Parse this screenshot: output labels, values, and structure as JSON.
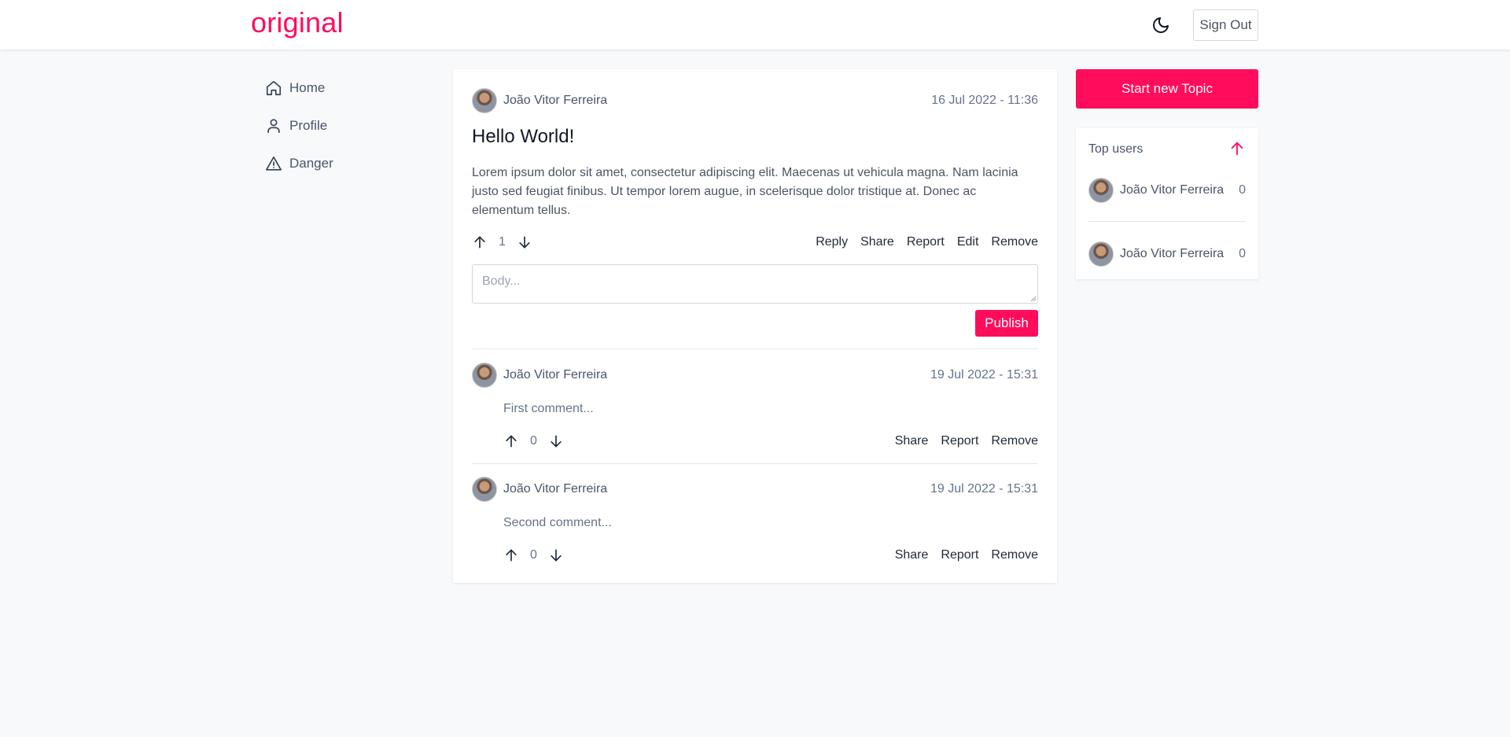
{
  "header": {
    "logo": "original",
    "sign_out_label": "Sign Out"
  },
  "sidebar": {
    "items": [
      {
        "label": "Home",
        "icon": "home-icon"
      },
      {
        "label": "Profile",
        "icon": "user-icon"
      },
      {
        "label": "Danger",
        "icon": "warning-icon"
      }
    ]
  },
  "post": {
    "author": "João Vitor Ferreira",
    "date": "16 Jul 2022 - 11:36",
    "title": "Hello World!",
    "body": "Lorem ipsum dolor sit amet, consectetur adipiscing elit. Maecenas ut vehicula magna. Nam lacinia justo sed feugiat finibus. Ut tempor lorem augue, in scelerisque dolor tristique at. Donec ac elementum tellus.",
    "votes": "1",
    "actions": {
      "reply": "Reply",
      "share": "Share",
      "report": "Report",
      "edit": "Edit",
      "remove": "Remove"
    }
  },
  "reply_form": {
    "placeholder": "Body...",
    "publish_label": "Publish"
  },
  "comments": [
    {
      "author": "João Vitor Ferreira",
      "date": "19 Jul 2022 - 15:31",
      "text": "First comment...",
      "votes": "0",
      "actions": {
        "share": "Share",
        "report": "Report",
        "remove": "Remove"
      }
    },
    {
      "author": "João Vitor Ferreira",
      "date": "19 Jul 2022 - 15:31",
      "text": "Second comment...",
      "votes": "0",
      "actions": {
        "share": "Share",
        "report": "Report",
        "remove": "Remove"
      }
    }
  ],
  "right": {
    "new_topic_label": "Start new Topic",
    "top_users_heading": "Top users",
    "top_users": [
      {
        "name": "João Vitor Ferreira",
        "score": "0"
      },
      {
        "name": "João Vitor Ferreira",
        "score": "0"
      }
    ]
  },
  "colors": {
    "accent": "#ff0d5c",
    "background": "#f8f9fb",
    "card": "#ffffff"
  }
}
